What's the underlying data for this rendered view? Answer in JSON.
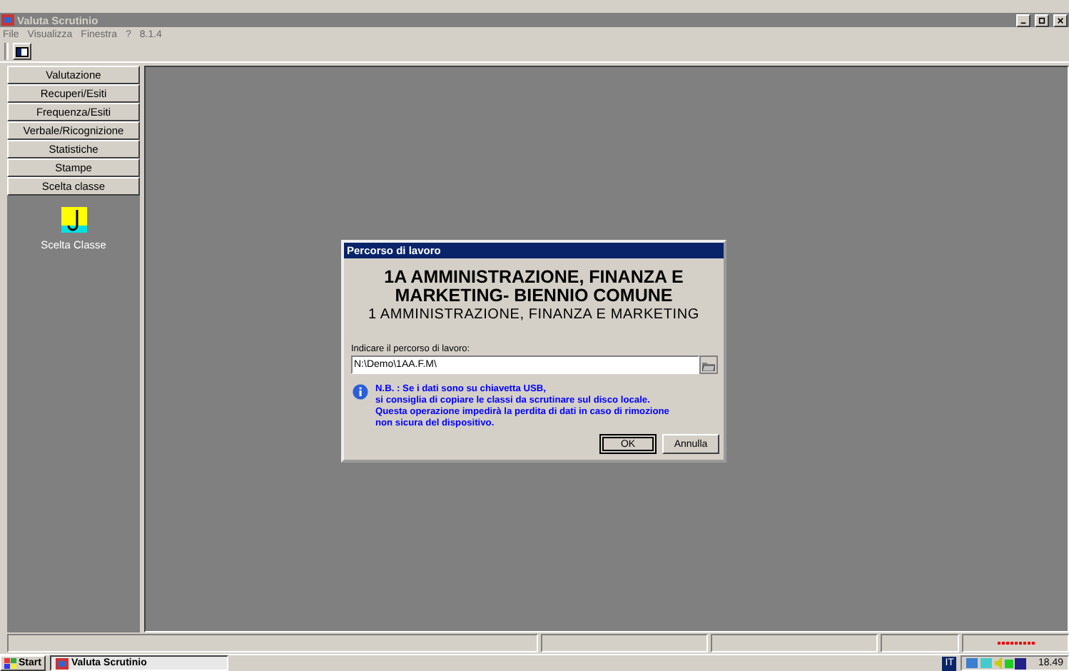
{
  "window": {
    "title": "Valuta Scrutinio"
  },
  "menu": [
    {
      "label": "File",
      "disabled": true
    },
    {
      "label": "Visualizza",
      "disabled": true
    },
    {
      "label": "Finestra",
      "disabled": true
    },
    {
      "label": "?",
      "disabled": true
    },
    {
      "label": "8.1.4",
      "disabled": true
    }
  ],
  "sidebar": {
    "items": [
      "Valutazione",
      "Recuperi/Esiti",
      "Frequenza/Esiti",
      "Verbale/Ricognizione",
      "Statistiche",
      "Stampe",
      "Scelta classe"
    ],
    "shortcut": "Scelta Classe"
  },
  "dialog": {
    "title": "Percorso di lavoro",
    "heading": [
      "1A AMMINISTRAZIONE, FINANZA E",
      "MARKETING- BIENNIO COMUNE"
    ],
    "subheading": "1 AMMINISTRAZIONE, FINANZA E MARKETING",
    "field_label": "Indicare il percorso di lavoro:",
    "path": "N:\\Demo\\1AA.F.M\\",
    "note": "N.B. : Se i dati sono su chiavetta USB,\nsi consiglia di copiare le classi da scrutinare sul disco locale.\nQuesta operazione impedirà la perdita di dati in caso di rimozione\nnon sicura del dispositivo.",
    "buttons": [
      {
        "label": "OK",
        "selected": true
      },
      {
        "label": "Annulla",
        "selected": false
      }
    ]
  },
  "taskbar": {
    "start": "Start",
    "task": "Valuta Scrutinio",
    "language": "IT",
    "clock": "18.49"
  }
}
